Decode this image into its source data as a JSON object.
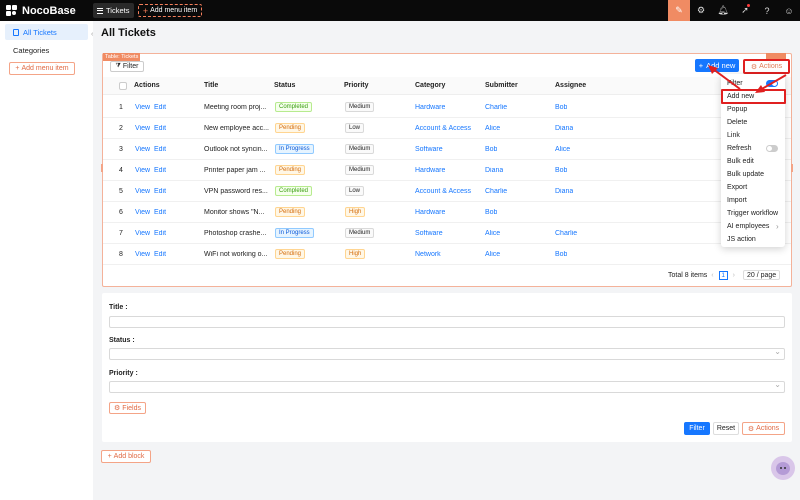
{
  "topbar": {
    "logo": "NocoBase",
    "menu_active": "Tickets",
    "menu_add": "Add menu item",
    "icons": [
      "design-icon",
      "gear-icon",
      "bell-icon",
      "rocket-icon",
      "help-icon",
      "user-icon"
    ]
  },
  "sidebar": {
    "items": [
      {
        "label": "All Tickets",
        "active": true
      },
      {
        "label": "Categories",
        "active": false
      }
    ],
    "add_label": "Add menu item"
  },
  "page": {
    "title": "All Tickets",
    "table_tag": "Table: Tickets",
    "filter_label": "Filter",
    "add_new_label": "Add new",
    "actions_label": "Actions"
  },
  "table": {
    "headers": [
      "Actions",
      "Title",
      "Status",
      "Priority",
      "Category",
      "Submitter",
      "Assignee"
    ],
    "view_label": "View",
    "edit_label": "Edit",
    "rows": [
      {
        "num": "1",
        "title": "Meeting room proj...",
        "status": "Completed",
        "priority": "Medium",
        "category": "Hardware",
        "submitter": "Charlie",
        "assignee": "Bob"
      },
      {
        "num": "2",
        "title": "New employee acc...",
        "status": "Pending",
        "priority": "Low",
        "category": "Account & Access",
        "submitter": "Alice",
        "assignee": "Diana"
      },
      {
        "num": "3",
        "title": "Outlook not syncin...",
        "status": "In Progress",
        "priority": "Medium",
        "category": "Software",
        "submitter": "Bob",
        "assignee": "Alice"
      },
      {
        "num": "4",
        "title": "Printer paper jam ...",
        "status": "Pending",
        "priority": "Medium",
        "category": "Hardware",
        "submitter": "Diana",
        "assignee": "Bob"
      },
      {
        "num": "5",
        "title": "VPN password res...",
        "status": "Completed",
        "priority": "Low",
        "category": "Account & Access",
        "submitter": "Charlie",
        "assignee": "Diana"
      },
      {
        "num": "6",
        "title": "Monitor shows \"N...",
        "status": "Pending",
        "priority": "High",
        "category": "Hardware",
        "submitter": "Bob",
        "assignee": ""
      },
      {
        "num": "7",
        "title": "Photoshop crashe...",
        "status": "In Progress",
        "priority": "Medium",
        "category": "Software",
        "submitter": "Alice",
        "assignee": "Charlie"
      },
      {
        "num": "8",
        "title": "WiFi not working o...",
        "status": "Pending",
        "priority": "High",
        "category": "Network",
        "submitter": "Alice",
        "assignee": "Bob"
      }
    ],
    "total": "Total 8 items",
    "page": "1",
    "page_size": "20 / page"
  },
  "dropdown": {
    "items": [
      "Filter",
      "Add new",
      "Popup",
      "Delete",
      "Link",
      "Refresh",
      "Bulk edit",
      "Bulk update",
      "Export",
      "Import",
      "Trigger workflow",
      "AI employees",
      "JS action"
    ],
    "filter_on": true,
    "refresh_on": false
  },
  "form": {
    "title_label": "Title :",
    "status_label": "Status :",
    "priority_label": "Priority :",
    "fields_label": "Fields",
    "filter_label": "Filter",
    "reset_label": "Reset",
    "actions_label": "Actions"
  },
  "add_block_label": "Add block",
  "colors": {
    "primary": "#1677ff",
    "accent": "#f08b63",
    "highlight": "#e02020"
  }
}
